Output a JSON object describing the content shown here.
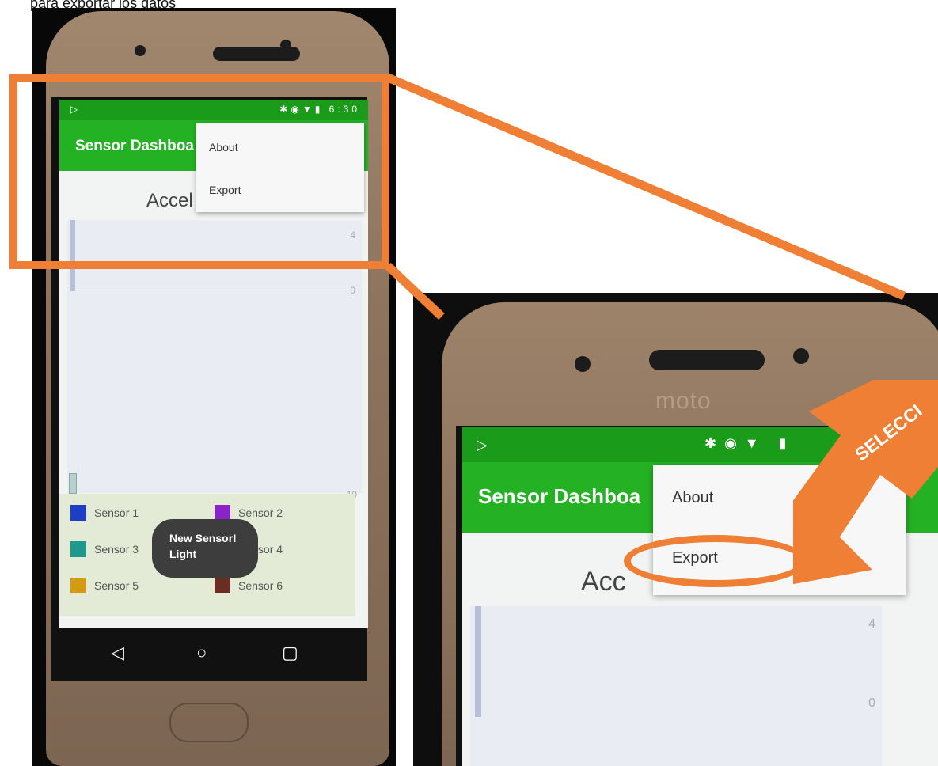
{
  "caption": "para exportar los datos",
  "left_phone": {
    "status_time": "6:30",
    "app_title": "Sensor Dashboa",
    "chart_heading": "Accel",
    "axis_ticks": [
      "4",
      "0",
      "-10"
    ],
    "menu_items": [
      {
        "label": "About"
      },
      {
        "label": "Export"
      }
    ],
    "legend": [
      {
        "label": "Sensor 1",
        "color": "#1d3fc6"
      },
      {
        "label": "Sensor 2",
        "color": "#8a23c8"
      },
      {
        "label": "Sensor 3",
        "color": "#1c9a8e"
      },
      {
        "label": "Sensor 4",
        "color": "#2f6e2f"
      },
      {
        "label": "Sensor 5",
        "color": "#d49a10"
      },
      {
        "label": "Sensor 6",
        "color": "#6b2d22"
      }
    ],
    "toast_lines": [
      "New Sensor!",
      "Light"
    ],
    "nav_icons": [
      "back-icon",
      "home-icon",
      "recents-icon"
    ]
  },
  "right_phone": {
    "brand": "moto",
    "app_title": "Sensor Dashboa",
    "chart_heading": "Acc",
    "axis_ticks": [
      "4",
      "0"
    ],
    "menu_items": [
      {
        "label": "About"
      },
      {
        "label": "Export"
      }
    ],
    "callout_text": "SELECCI"
  },
  "colors": {
    "highlight": "#ef7f34",
    "app_green": "#24b224",
    "status_green": "#1a9c1a"
  }
}
